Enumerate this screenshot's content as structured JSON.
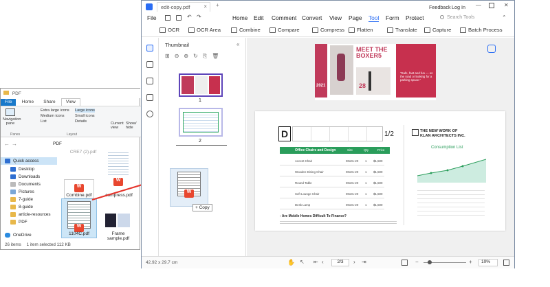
{
  "explorer": {
    "title": "PDF",
    "tabs": [
      "File",
      "Home",
      "Share",
      "View"
    ],
    "ribbon": {
      "navigation_pane": "Navigation pane",
      "panes_label": "Panes",
      "layout_items": [
        "Extra large icons",
        "Large icons",
        "Medium icons",
        "Small icons",
        "List",
        "Details"
      ],
      "layout_label": "Layout",
      "current_view": "Current view",
      "show_hide": "Show/ hide"
    },
    "address": "PDF",
    "nav": [
      "Quick access",
      "Desktop",
      "Downloads",
      "Documents",
      "Pictures",
      "7-guide",
      "8-guide",
      "article-resources",
      "PDF",
      "OneDrive"
    ],
    "files": [
      {
        "name": "Combine.pdf"
      },
      {
        "name": "compress.pdf"
      },
      {
        "name": "1104C.pdf"
      },
      {
        "name": "Frame sample.pdf"
      }
    ],
    "status": {
      "items": "26 items",
      "selected": "1 item selected  112 KB"
    },
    "top_cut_label": "CRE7 (2).pdf"
  },
  "app": {
    "tab_title": "edit-copy.pdf",
    "menu": {
      "file": "File",
      "home": "Home",
      "edit": "Edit",
      "comment": "Comment",
      "convert": "Convert",
      "view": "View",
      "page": "Page",
      "tool": "Tool",
      "form": "Form",
      "protect": "Protect"
    },
    "feedback": "Feedback",
    "login": "Log In",
    "search_placeholder": "Search Tools",
    "toolbar": {
      "ocr": "OCR",
      "ocr_area": "OCR Area",
      "combine": "Combine",
      "compare": "Compare",
      "compress": "Compress",
      "flatten": "Flatten",
      "translate": "Translate",
      "capture": "Capture",
      "batch": "Batch Process"
    },
    "thumbnail": {
      "title": "Thumbnail",
      "pages": [
        "1",
        "2"
      ],
      "copy_label": "+ Copy"
    },
    "doc": {
      "hero_title": "MEET THE BOXER5",
      "side_quote": "\"Safe, fast and fun — on the road or looking for a parking space.\"",
      "year": "2021",
      "days": "28",
      "page2_letter": "D",
      "invoice_title": "Office Chairs and Design",
      "cols": [
        "Site",
        "Qty",
        "Price"
      ],
      "rows": [
        {
          "item": "Accent Chair",
          "size": "00x01-20",
          "qty": "1",
          "price": "$1,500"
        },
        {
          "item": "Wooden Dining Chair",
          "size": "00x01-20",
          "qty": "1",
          "price": "$1,500"
        },
        {
          "item": "Round Table",
          "size": "00x01-20",
          "qty": "1",
          "price": "$1,500"
        },
        {
          "item": "Soft Lounge Chair",
          "size": "00x01-20",
          "qty": "1",
          "price": "$1,500"
        },
        {
          "item": "Desk Lamp",
          "size": "00x01-20",
          "qty": "1",
          "price": "$1,500"
        }
      ],
      "footer_title": "- Are Mobile Homes Difficult To Finance?",
      "logo_line1": "THE NEW WORK OF",
      "logo_line2": "KLAN ARCHITECTS INC.",
      "consumption": "Consumption List",
      "fraction": "1/2"
    },
    "status": {
      "size": "42.92 x 29.7 cm",
      "page": "2/3",
      "zoom": "10%"
    }
  }
}
